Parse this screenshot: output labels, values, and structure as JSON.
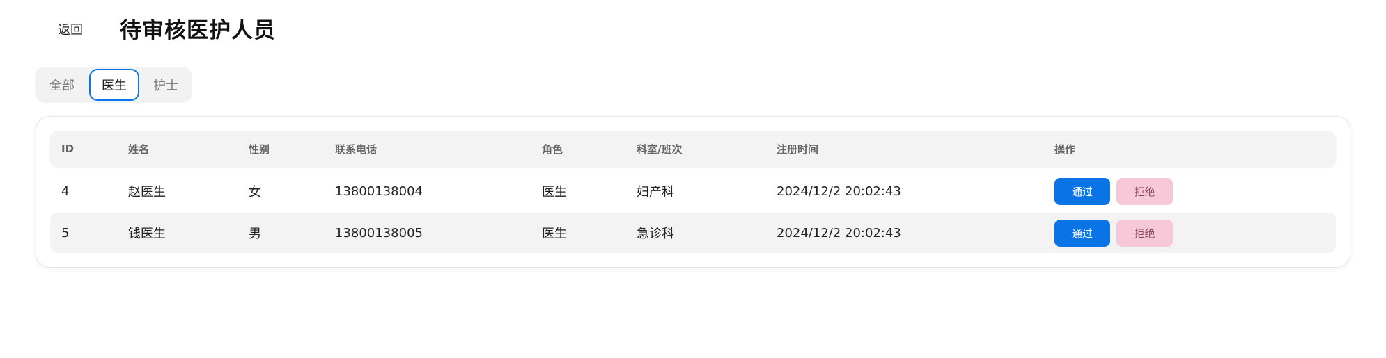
{
  "header": {
    "back_label": "返回",
    "title": "待审核医护人员"
  },
  "tabs": [
    {
      "label": "全部",
      "active": false
    },
    {
      "label": "医生",
      "active": true
    },
    {
      "label": "护士",
      "active": false
    }
  ],
  "table": {
    "columns": [
      "ID",
      "姓名",
      "性别",
      "联系电话",
      "角色",
      "科室/班次",
      "注册时间",
      "操作"
    ],
    "rows": [
      {
        "id": "4",
        "name": "赵医生",
        "gender": "女",
        "phone": "13800138004",
        "role": "医生",
        "dept": "妇产科",
        "registered": "2024/12/2 20:02:43",
        "approve_label": "通过",
        "reject_label": "拒绝"
      },
      {
        "id": "5",
        "name": "钱医生",
        "gender": "男",
        "phone": "13800138005",
        "role": "医生",
        "dept": "急诊科",
        "registered": "2024/12/2 20:02:43",
        "approve_label": "通过",
        "reject_label": "拒绝"
      }
    ]
  },
  "colors": {
    "accent": "#0a74e6",
    "reject_bg": "#f7c9d8",
    "header_bg": "#f3f3f3"
  }
}
